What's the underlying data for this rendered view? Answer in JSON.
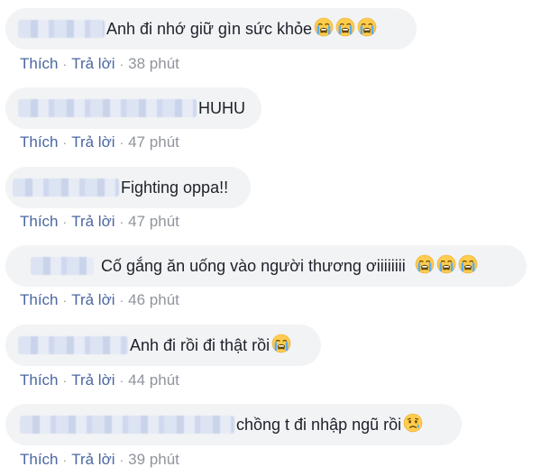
{
  "comments": [
    {
      "text": "Anh đi nhớ giữ gìn sức khỏe",
      "emojis": [
        "crying-face-icon",
        "crying-face-icon",
        "crying-face-icon"
      ],
      "like_label": "Thích",
      "reply_label": "Trả lời",
      "separator": "·",
      "time": "38 phút"
    },
    {
      "text": "HUHU",
      "emojis": [],
      "like_label": "Thích",
      "reply_label": "Trả lời",
      "separator": "·",
      "time": "47 phút"
    },
    {
      "text": "Fighting oppa!!",
      "emojis": [],
      "like_label": "Thích",
      "reply_label": "Trả lời",
      "separator": "·",
      "time": "47 phút"
    },
    {
      "text": "Cố gắng ăn uống vào người thương ơiiiiiiii",
      "emojis": [
        "crying-face-icon",
        "crying-face-icon",
        "crying-face-icon"
      ],
      "like_label": "Thích",
      "reply_label": "Trả lời",
      "separator": "·",
      "time": "46 phút"
    },
    {
      "text": "Anh đi rồi đi thật rồi",
      "emojis": [
        "crying-face-icon"
      ],
      "like_label": "Thích",
      "reply_label": "Trả lời",
      "separator": "·",
      "time": "44 phút"
    },
    {
      "text": "chồng t đi nhập ngũ rồi",
      "emojis": [
        "sad-tear-face-icon"
      ],
      "like_label": "Thích",
      "reply_label": "Trả lời",
      "separator": "·",
      "time": "39 phút"
    }
  ],
  "colors": {
    "bubble_bg": "#f2f3f5",
    "link": "#4b67a1",
    "meta": "#90949c",
    "text": "#1d2129",
    "emoji_face": "#ffcc4d",
    "emoji_tear": "#5dadec"
  }
}
